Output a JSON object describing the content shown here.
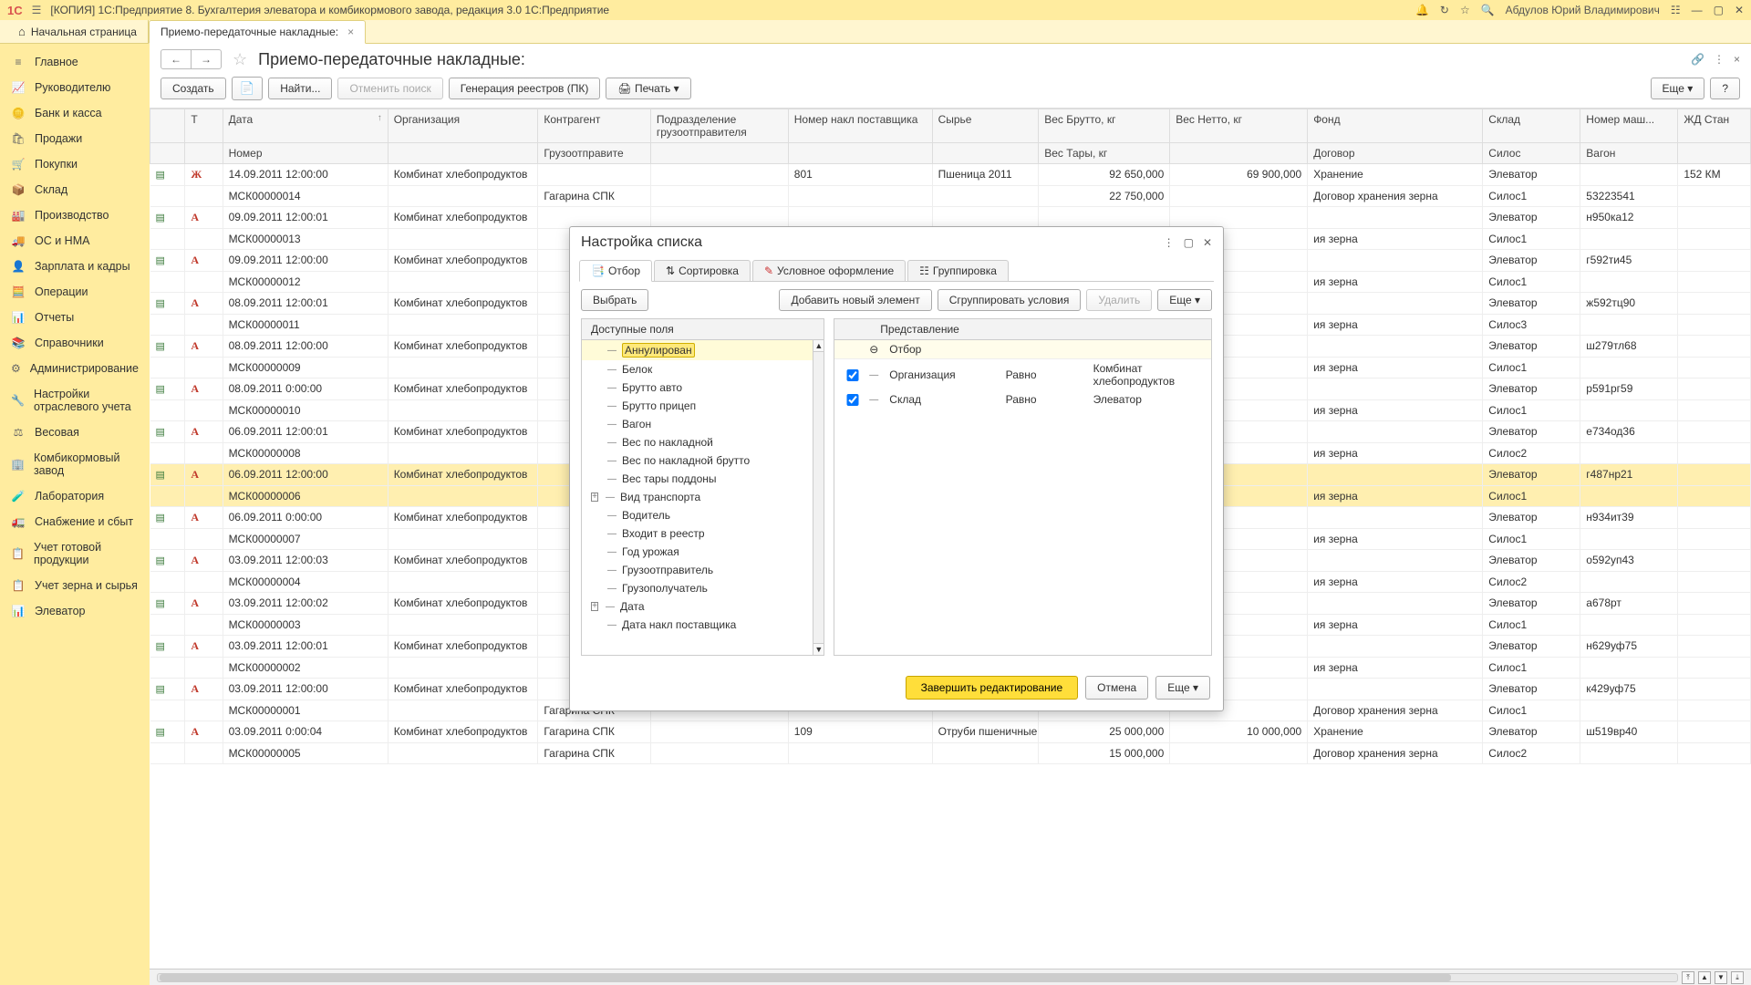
{
  "titlebar": {
    "logo": "1С",
    "title": "[КОПИЯ] 1С:Предприятие 8. Бухгалтерия элеватора и комбикормового завода, редакция 3.0 1С:Предприятие",
    "user": "Абдулов Юрий Владимирович"
  },
  "tabs": {
    "home": "Начальная страница",
    "t1": "Приемо-передаточные накладные:"
  },
  "sidebar": [
    {
      "icon": "≡",
      "label": "Главное"
    },
    {
      "icon": "📈",
      "label": "Руководителю"
    },
    {
      "icon": "🪙",
      "label": "Банк и касса"
    },
    {
      "icon": "🛍",
      "label": "Продажи"
    },
    {
      "icon": "🛒",
      "label": "Покупки"
    },
    {
      "icon": "📦",
      "label": "Склад"
    },
    {
      "icon": "🏭",
      "label": "Производство"
    },
    {
      "icon": "🚚",
      "label": "ОС и НМА"
    },
    {
      "icon": "👤",
      "label": "Зарплата и кадры"
    },
    {
      "icon": "🧮",
      "label": "Операции"
    },
    {
      "icon": "📊",
      "label": "Отчеты"
    },
    {
      "icon": "📚",
      "label": "Справочники"
    },
    {
      "icon": "⚙",
      "label": "Администрирование"
    },
    {
      "icon": "🔧",
      "label": "Настройки отраслевого учета"
    },
    {
      "icon": "⚖",
      "label": "Весовая"
    },
    {
      "icon": "🏢",
      "label": "Комбикормовый завод"
    },
    {
      "icon": "🧪",
      "label": "Лаборатория"
    },
    {
      "icon": "🚛",
      "label": "Снабжение и сбыт"
    },
    {
      "icon": "📋",
      "label": "Учет готовой продукции"
    },
    {
      "icon": "📋",
      "label": "Учет зерна и сырья"
    },
    {
      "icon": "📊",
      "label": "Элеватор"
    }
  ],
  "page": {
    "title": "Приемо-передаточные накладные:",
    "toolbar": {
      "create": "Создать",
      "find": "Найти...",
      "cancel_find": "Отменить поиск",
      "gen": "Генерация реестров (ПК)",
      "print": "Печать",
      "more": "Еще",
      "help": "?"
    }
  },
  "columns": {
    "g1": [
      "",
      "Т",
      "Дата",
      "Организация",
      "Контрагент",
      "Подразделение грузоотправителя",
      "Номер накл поставщика",
      "Сырье",
      "Вес Брутто, кг",
      "Вес Нетто, кг",
      "Фонд",
      "Склад",
      "Номер маш...",
      "ЖД Стан"
    ],
    "g2": [
      "",
      "",
      "Номер",
      "",
      "Грузоотправите",
      "",
      "",
      "",
      "Вес Тары, кг",
      "",
      "Договор",
      "Силос",
      "Вагон",
      ""
    ]
  },
  "rows": [
    {
      "t": "Ж",
      "date": "14.09.2011 12:00:00",
      "num": "МСК00000014",
      "org": "Комбинат хлебопродуктов",
      "kon": "",
      "kon2": "Гагарина СПК",
      "nakl": "801",
      "syr": "Пшеница 2011",
      "brutto": "92 650,000",
      "tara": "22 750,000",
      "netto": "69 900,000",
      "fond": "Хранение",
      "dog": "Договор хранения зерна",
      "skl": "Элеватор",
      "sil": "Силос1",
      "mash": "",
      "vag": "53223541",
      "zhd": "152 КМ"
    },
    {
      "t": "А",
      "date": "09.09.2011 12:00:01",
      "num": "МСК00000013",
      "org": "Комбинат хлебопродуктов",
      "fond": "",
      "dog": "ия зерна",
      "skl": "Элеватор",
      "sil": "Силос1",
      "mash": "н950ка12"
    },
    {
      "t": "А",
      "date": "09.09.2011 12:00:00",
      "num": "МСК00000012",
      "org": "Комбинат хлебопродуктов",
      "dog": "ия зерна",
      "skl": "Элеватор",
      "sil": "Силос1",
      "mash": "г592ти45"
    },
    {
      "t": "А",
      "date": "08.09.2011 12:00:01",
      "num": "МСК00000011",
      "org": "Комбинат хлебопродуктов",
      "dog": "ия зерна",
      "skl": "Элеватор",
      "sil": "Силос3",
      "mash": "ж592тц90"
    },
    {
      "t": "А",
      "date": "08.09.2011 12:00:00",
      "num": "МСК00000009",
      "org": "Комбинат хлебопродуктов",
      "dog": "ия зерна",
      "skl": "Элеватор",
      "sil": "Силос1",
      "mash": "ш279тл68"
    },
    {
      "t": "А",
      "date": "08.09.2011 0:00:00",
      "num": "МСК00000010",
      "org": "Комбинат хлебопродуктов",
      "dog": "ия зерна",
      "skl": "Элеватор",
      "sil": "Силос1",
      "mash": "р591рг59"
    },
    {
      "t": "А",
      "date": "06.09.2011 12:00:01",
      "num": "МСК00000008",
      "org": "Комбинат хлебопродуктов",
      "dog": "ия зерна",
      "skl": "Элеватор",
      "sil": "Силос2",
      "mash": "е734од36"
    },
    {
      "t": "А",
      "date": "06.09.2011 12:00:00",
      "num": "МСК00000006",
      "org": "Комбинат хлебопродуктов",
      "dog": "ия зерна",
      "skl": "Элеватор",
      "sil": "Силос1",
      "mash": "г487нр21",
      "hl": true
    },
    {
      "t": "А",
      "date": "06.09.2011 0:00:00",
      "num": "МСК00000007",
      "org": "Комбинат хлебопродуктов",
      "dog": "ия зерна",
      "skl": "Элеватор",
      "sil": "Силос1",
      "mash": "н934ит39"
    },
    {
      "t": "А",
      "date": "03.09.2011 12:00:03",
      "num": "МСК00000004",
      "org": "Комбинат хлебопродуктов",
      "dog": "ия зерна",
      "skl": "Элеватор",
      "sil": "Силос2",
      "mash": "о592уп43"
    },
    {
      "t": "А",
      "date": "03.09.2011 12:00:02",
      "num": "МСК00000003",
      "org": "Комбинат хлебопродуктов",
      "dog": "ия зерна",
      "skl": "Элеватор",
      "sil": "Силос1",
      "mash": "а678рт"
    },
    {
      "t": "А",
      "date": "03.09.2011 12:00:01",
      "num": "МСК00000002",
      "org": "Комбинат хлебопродуктов",
      "dog": "ия зерна",
      "skl": "Элеватор",
      "sil": "Силос1",
      "mash": "н629уф75"
    },
    {
      "t": "А",
      "date": "03.09.2011 12:00:00",
      "num": "МСК00000001",
      "org": "Комбинат хлебопродуктов",
      "kon2": "Гагарина СПК",
      "brutto": "",
      "tara": "",
      "dog": "Договор хранения зерна",
      "skl": "Элеватор",
      "sil": "Силос1",
      "mash": "к429уф75"
    },
    {
      "t": "А",
      "date": "03.09.2011 0:00:04",
      "num": "МСК00000005",
      "org": "Комбинат хлебопродуктов",
      "kon": "Гагарина СПК",
      "kon2": "Гагарина СПК",
      "nakl": "109",
      "syr": "Отруби пшеничные",
      "brutto": "25 000,000",
      "tara": "15 000,000",
      "netto": "10 000,000",
      "fond": "Хранение",
      "dog": "Договор хранения зерна",
      "skl": "Элеватор",
      "sil": "Силос2",
      "mash": "ш519вр40"
    }
  ],
  "dialog": {
    "title": "Настройка списка",
    "tabs": {
      "sel": "Отбор",
      "sort": "Сортировка",
      "cond": "Условное оформление",
      "grp": "Группировка"
    },
    "btns": {
      "select": "Выбрать",
      "add": "Добавить новый элемент",
      "group": "Сгруппировать условия",
      "del": "Удалить",
      "more": "Еще"
    },
    "left_hd": "Доступные поля",
    "right_hd": "Представление",
    "fields": [
      "Аннулирован",
      "Белок",
      "Брутто авто",
      "Брутто прицеп",
      "Вагон",
      "Вес по накладной",
      "Вес по накладной брутто",
      "Вес тары поддоны",
      "Вид транспорта",
      "Водитель",
      "Входит в реестр",
      "Год урожая",
      "Грузоотправитель",
      "Грузополучатель",
      "Дата",
      "Дата накл поставщика"
    ],
    "right_root": "Отбор",
    "conds": [
      {
        "field": "Организация",
        "op": "Равно",
        "val": "Комбинат хлебопродуктов"
      },
      {
        "field": "Склад",
        "op": "Равно",
        "val": "Элеватор"
      }
    ],
    "footer": {
      "ok": "Завершить редактирование",
      "cancel": "Отмена",
      "more": "Еще"
    }
  }
}
